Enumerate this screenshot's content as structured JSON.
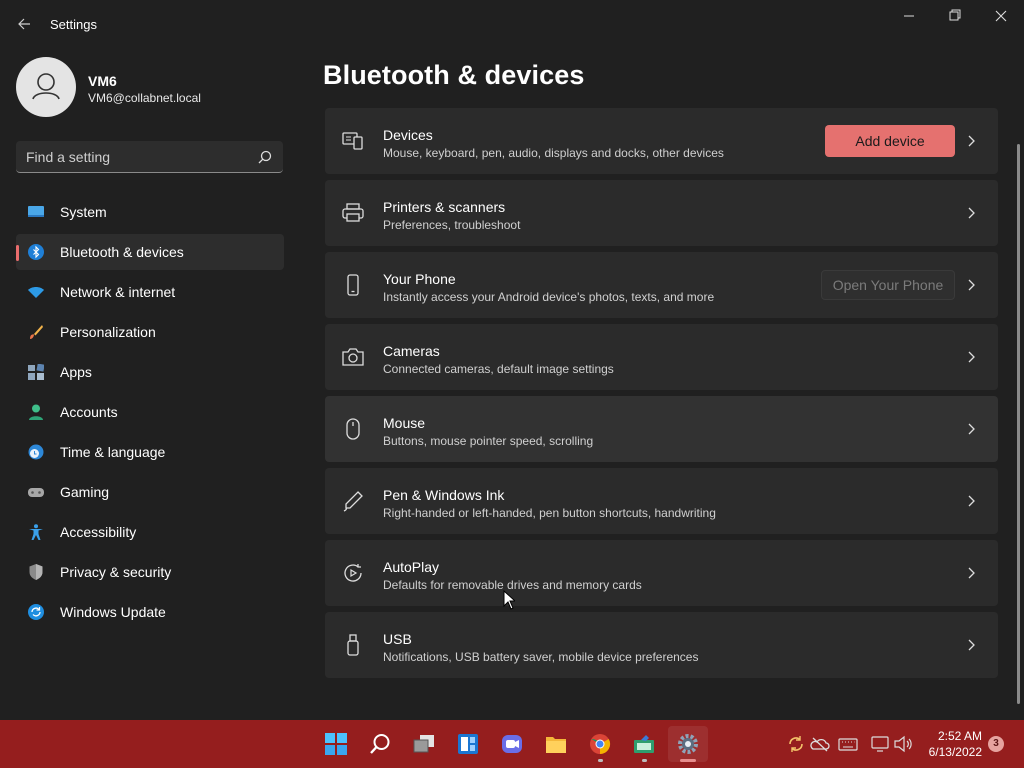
{
  "window": {
    "title": "Settings"
  },
  "profile": {
    "name": "VM6",
    "email": "VM6@collabnet.local"
  },
  "search": {
    "placeholder": "Find a setting"
  },
  "nav": {
    "items": [
      {
        "label": "System",
        "icon": "monitor-icon"
      },
      {
        "label": "Bluetooth & devices",
        "icon": "bluetooth-icon",
        "selected": true
      },
      {
        "label": "Network & internet",
        "icon": "wifi-icon"
      },
      {
        "label": "Personalization",
        "icon": "brush-icon"
      },
      {
        "label": "Apps",
        "icon": "apps-icon"
      },
      {
        "label": "Accounts",
        "icon": "person-icon"
      },
      {
        "label": "Time & language",
        "icon": "globe-clock-icon"
      },
      {
        "label": "Gaming",
        "icon": "gamepad-icon"
      },
      {
        "label": "Accessibility",
        "icon": "accessibility-icon"
      },
      {
        "label": "Privacy & security",
        "icon": "shield-icon"
      },
      {
        "label": "Windows Update",
        "icon": "update-icon"
      }
    ]
  },
  "main": {
    "title": "Bluetooth & devices",
    "cards": [
      {
        "title": "Devices",
        "description": "Mouse, keyboard, pen, audio, displays and docks, other devices",
        "icon": "devices-icon",
        "button": "Add device"
      },
      {
        "title": "Printers & scanners",
        "description": "Preferences, troubleshoot",
        "icon": "printer-icon"
      },
      {
        "title": "Your Phone",
        "description": "Instantly access your Android device's photos, texts, and more",
        "icon": "phone-icon",
        "button": "Open Your Phone"
      },
      {
        "title": "Cameras",
        "description": "Connected cameras, default image settings",
        "icon": "camera-icon"
      },
      {
        "title": "Mouse",
        "description": "Buttons, mouse pointer speed, scrolling",
        "icon": "mouse-icon"
      },
      {
        "title": "Pen & Windows Ink",
        "description": "Right-handed or left-handed, pen button shortcuts, handwriting",
        "icon": "pen-icon"
      },
      {
        "title": "AutoPlay",
        "description": "Defaults for removable drives and memory cards",
        "icon": "autoplay-icon"
      },
      {
        "title": "USB",
        "description": "Notifications, USB battery saver, mobile device preferences",
        "icon": "usb-icon"
      }
    ]
  },
  "taskbar": {
    "apps": [
      "start-icon",
      "search-icon",
      "task-view-icon",
      "widgets-icon",
      "chat-icon",
      "file-explorer-icon",
      "chrome-icon",
      "app-icon",
      "settings-icon"
    ],
    "tray": [
      "sync-icon",
      "onedrive-icon",
      "keyboard-icon",
      "network-icon",
      "volume-icon"
    ],
    "time": "2:52 AM",
    "date": "6/13/2022",
    "notifications": "3"
  },
  "colors": {
    "accent": "#e5716f",
    "taskbar": "#951e1e",
    "background": "#202020",
    "card": "#2b2b2b"
  }
}
